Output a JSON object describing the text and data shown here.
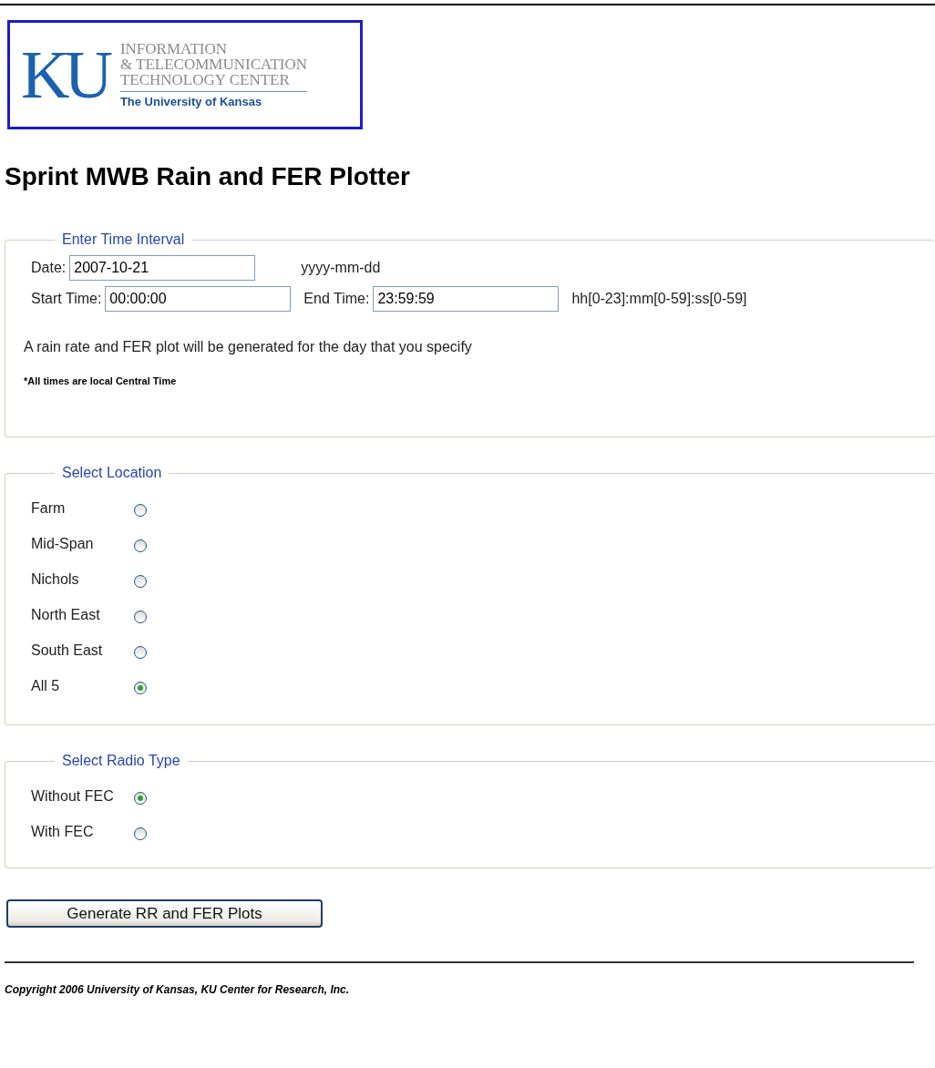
{
  "logo": {
    "mark": "KU",
    "lines": [
      "INFORMATION",
      "& TELECOMMUNICATION",
      "TECHNOLOGY CENTER"
    ],
    "university": "The University of Kansas"
  },
  "title": "Sprint MWB Rain and FER Plotter",
  "time_interval": {
    "legend": "Enter Time Interval",
    "date": {
      "label": "Date:",
      "value": "2007-10-21",
      "hint": "yyyy-mm-dd"
    },
    "start": {
      "label": "Start Time:",
      "value": "00:00:00"
    },
    "end": {
      "label": "End Time:",
      "value": "23:59:59",
      "hint": "hh[0-23]:mm[0-59]:ss[0-59]"
    },
    "description": "A rain rate and FER plot will be generated for the day that you specify",
    "note": "*All times are local Central Time"
  },
  "location": {
    "legend": "Select Location",
    "options": [
      {
        "label": "Farm",
        "selected": false
      },
      {
        "label": "Mid-Span",
        "selected": false
      },
      {
        "label": "Nichols",
        "selected": false
      },
      {
        "label": "North East",
        "selected": false
      },
      {
        "label": "South East",
        "selected": false
      },
      {
        "label": "All 5",
        "selected": true
      }
    ]
  },
  "radio_type": {
    "legend": "Select Radio Type",
    "options": [
      {
        "label": "Without FEC",
        "selected": true
      },
      {
        "label": "With FEC",
        "selected": false
      }
    ]
  },
  "button": "Generate RR and FER Plots",
  "copyright": "Copyright 2006 University of Kansas, KU Center for Research, Inc."
}
